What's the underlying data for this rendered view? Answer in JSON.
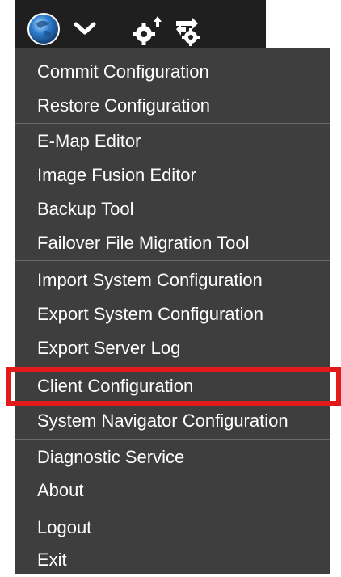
{
  "toolbar": {
    "icons": [
      "globe-icon",
      "chevron-down-icon",
      "gear-upload-icon",
      "gear-swap-icon"
    ]
  },
  "menu": {
    "groups": [
      {
        "items": [
          "Commit Configuration",
          "Restore Configuration"
        ]
      },
      {
        "items": [
          "E-Map Editor",
          "Image Fusion Editor",
          "Backup Tool",
          "Failover File Migration Tool"
        ]
      },
      {
        "items": [
          "Import System Configuration",
          "Export System Configuration",
          "Export Server Log",
          "Client Configuration",
          "System Navigator Configuration"
        ]
      },
      {
        "items": [
          "Diagnostic Service",
          "About"
        ]
      },
      {
        "items": [
          "Logout",
          "Exit"
        ]
      }
    ],
    "highlighted_item": "Client Configuration"
  },
  "colors": {
    "toolbar_bg": "#1f1f1f",
    "menu_bg": "#3e3e3e",
    "separator": "#6a6a6a",
    "text": "#ffffff",
    "highlight": "#e21a1a"
  }
}
